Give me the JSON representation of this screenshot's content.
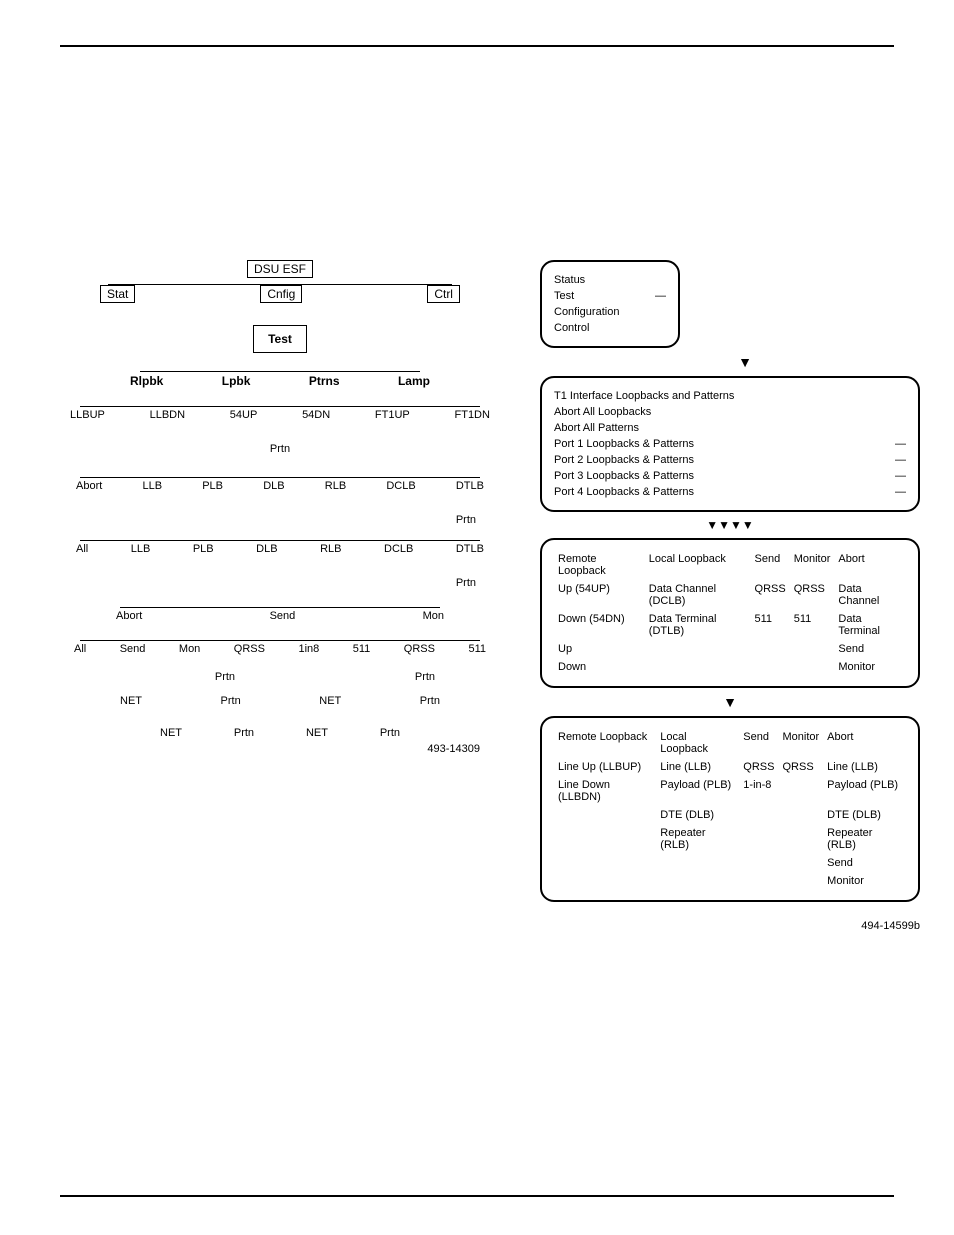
{
  "tree": {
    "root": "DSU ESF",
    "l1": {
      "stat": "Stat",
      "cnfig": "Cnfig",
      "ctrl": "Ctrl"
    },
    "test": "Test",
    "l2": {
      "rlpbk": "Rlpbk",
      "lpbk": "Lpbk",
      "ptrns": "Ptrns",
      "lamp": "Lamp"
    },
    "rlpbk_row": [
      "LLBUP",
      "LLBDN",
      "54UP",
      "54DN",
      "FT1UP",
      "FT1DN"
    ],
    "rlpbk_prtn": "Prtn",
    "lpbk_row1": [
      "Abort",
      "LLB",
      "PLB",
      "DLB",
      "RLB",
      "DCLB",
      "DTLB"
    ],
    "lpbk_prtn1": "Prtn",
    "lpbk_row2": [
      "All",
      "LLB",
      "PLB",
      "DLB",
      "RLB",
      "DCLB",
      "DTLB"
    ],
    "lpbk_prtn2": "Prtn",
    "ptrns_row": {
      "abort": "Abort",
      "send": "Send",
      "mon": "Mon"
    },
    "ptrns_leaf": [
      "All",
      "Send",
      "Mon",
      "QRSS",
      "1in8",
      "511",
      "QRSS",
      "511"
    ],
    "ptrns_prtn": [
      "Prtn",
      "Prtn"
    ],
    "net_prtn": [
      "NET",
      "Prtn",
      "NET",
      "Prtn"
    ],
    "net_prtn2": [
      "NET",
      "Prtn",
      "NET",
      "Prtn"
    ],
    "fig": "493-14309"
  },
  "flow": {
    "box1": [
      "Status",
      "Test",
      "Configuration",
      "Control"
    ],
    "box2": {
      "title": "T1 Interface Loopbacks and Patterns",
      "lines": [
        "Abort All Loopbacks",
        "Abort All Patterns",
        "Port 1 Loopbacks & Patterns",
        "Port 2 Loopbacks & Patterns",
        "Port 3 Loopbacks & Patterns",
        "Port 4 Loopbacks & Patterns"
      ]
    },
    "box3": {
      "hdr": [
        "Remote Loopback",
        "Local Loopback",
        "Send",
        "Monitor",
        "Abort"
      ],
      "r1": [
        "Up (54UP)",
        "Data Channel (DCLB)",
        "QRSS",
        "QRSS",
        "Data Channel"
      ],
      "r2": [
        "Down (54DN)",
        "Data Terminal (DTLB)",
        "511",
        "511",
        "Data Terminal"
      ],
      "r3": [
        "Up",
        "",
        "",
        "",
        "Send"
      ],
      "r4": [
        "Down",
        "",
        "",
        "",
        "Monitor"
      ]
    },
    "box4": {
      "hdr": [
        "Remote Loopback",
        "Local Loopback",
        "Send",
        "Monitor",
        "Abort"
      ],
      "r1": [
        "Line Up (LLBUP)",
        "Line (LLB)",
        "QRSS",
        "QRSS",
        "Line (LLB)"
      ],
      "r2": [
        "Line Down (LLBDN)",
        "Payload (PLB)",
        "1-in-8",
        "",
        "Payload (PLB)"
      ],
      "r3": [
        "",
        "DTE (DLB)",
        "",
        "",
        "DTE (DLB)"
      ],
      "r4": [
        "",
        "Repeater (RLB)",
        "",
        "",
        "Repeater (RLB)"
      ],
      "r5": [
        "",
        "",
        "",
        "",
        "Send"
      ],
      "r6": [
        "",
        "",
        "",
        "",
        "Monitor"
      ]
    },
    "fig": "494-14599b"
  }
}
